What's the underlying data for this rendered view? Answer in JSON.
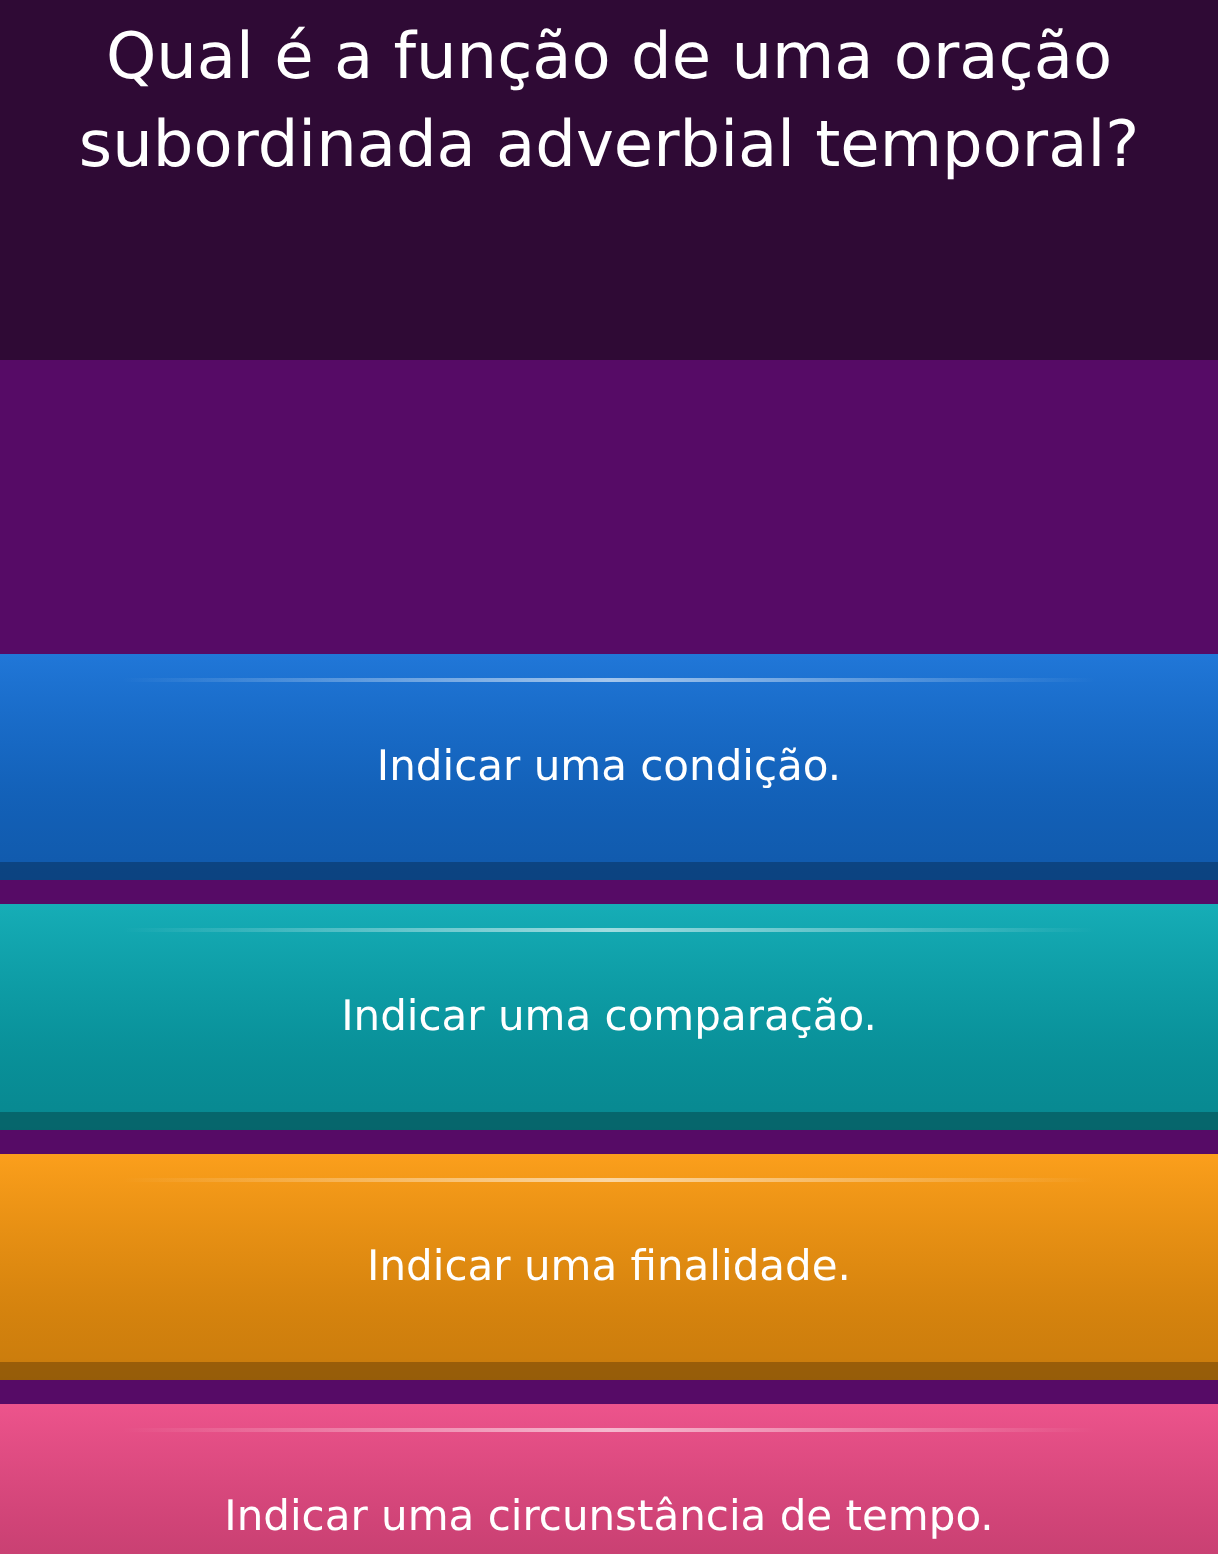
{
  "question": "Qual é a função de uma oração subordinada adverbial temporal?",
  "answers": [
    {
      "label": "Indicar uma condição.",
      "color": "#1570d6"
    },
    {
      "label": "Indicar uma comparação.",
      "color": "#0aa9b3"
    },
    {
      "label": "Indicar uma finalidade.",
      "color": "#fb9a10"
    },
    {
      "label": "Indicar uma circunstância de tempo.",
      "color": "#ec4b86"
    }
  ]
}
